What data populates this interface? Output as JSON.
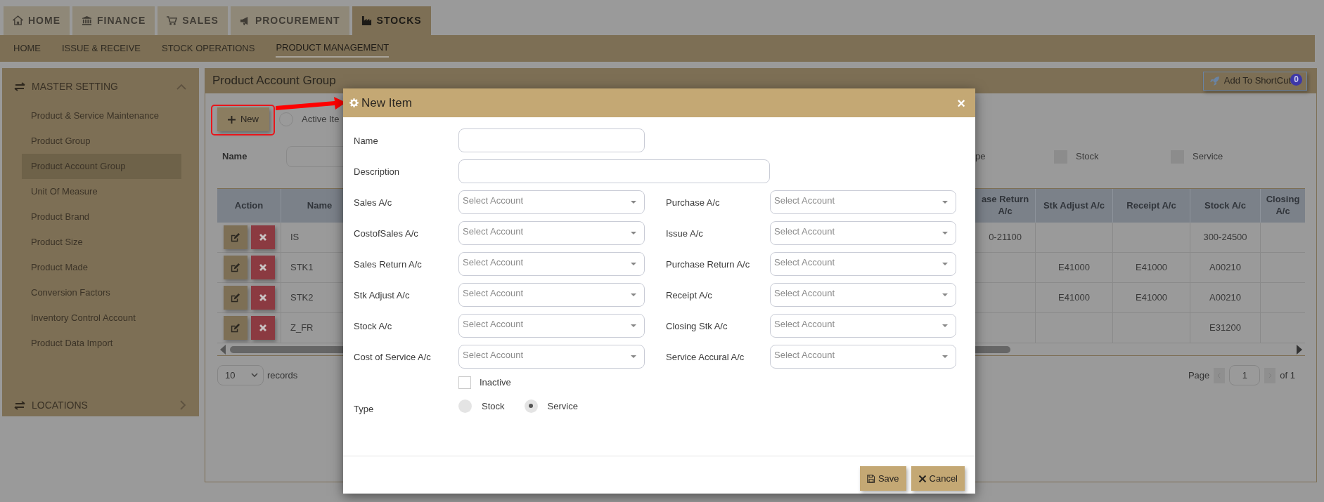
{
  "top_tabs": [
    {
      "label": "HOME",
      "selected": false
    },
    {
      "label": "FINANCE",
      "selected": false
    },
    {
      "label": "SALES",
      "selected": false
    },
    {
      "label": "PROCUREMENT",
      "selected": false
    },
    {
      "label": "STOCKS",
      "selected": true
    }
  ],
  "sub_nav": [
    {
      "label": "HOME",
      "selected": false
    },
    {
      "label": "ISSUE & RECEIVE",
      "selected": false
    },
    {
      "label": "STOCK OPERATIONS",
      "selected": false
    },
    {
      "label": "PRODUCT MANAGEMENT",
      "selected": true
    }
  ],
  "sidebar": {
    "sections": [
      {
        "title": "MASTER SETTING",
        "expanded": true,
        "items": [
          {
            "label": "Product & Service Maintenance",
            "selected": false
          },
          {
            "label": "Product Group",
            "selected": false
          },
          {
            "label": "Product Account Group",
            "selected": true
          },
          {
            "label": "Unit Of Measure",
            "selected": false
          },
          {
            "label": "Product Brand",
            "selected": false
          },
          {
            "label": "Product Size",
            "selected": false
          },
          {
            "label": "Product Made",
            "selected": false
          },
          {
            "label": "Conversion Factors",
            "selected": false
          },
          {
            "label": "Inventory Control Account",
            "selected": false
          },
          {
            "label": "Product Data Import",
            "selected": false
          }
        ]
      },
      {
        "title": "LOCATIONS",
        "expanded": false
      }
    ]
  },
  "panel": {
    "title": "Product Account Group",
    "shortcut_button": {
      "label": "Add To ShortCut",
      "badge": "0"
    },
    "new_button": "New",
    "active_filter": {
      "label": "Active Ite",
      "checked": false
    },
    "filters": {
      "name_label": "Name",
      "type_label": "pe",
      "type_options": [
        {
          "label": "Stock",
          "checked": false
        },
        {
          "label": "Service",
          "checked": false
        }
      ]
    },
    "table": {
      "left_columns": [
        "Action",
        "Name"
      ],
      "right_columns": [
        "ase Return A/c",
        "Stk Adjust A/c",
        "Receipt A/c",
        "Stock A/c",
        "Closing A/c"
      ],
      "rows": [
        {
          "name": "IS",
          "cells": [
            "0-21100",
            null,
            null,
            "300-24500",
            null
          ]
        },
        {
          "name": "STK1",
          "cells": [
            null,
            "E41000",
            "E41000",
            "A00210",
            null
          ]
        },
        {
          "name": "STK2",
          "cells": [
            null,
            "E41000",
            "E41000",
            "A00210",
            null
          ]
        },
        {
          "name": "Z_FR",
          "cells": [
            null,
            null,
            null,
            "E31200",
            null
          ]
        }
      ]
    },
    "page_size": "10",
    "records_label": "records",
    "pagination": {
      "page_label": "Page",
      "page": "1",
      "of_label": "of 1"
    }
  },
  "modal": {
    "title": "New Item",
    "close": "×",
    "fields": [
      {
        "kind": "text",
        "label": "Name",
        "wide": false
      },
      {
        "kind": "text",
        "label": "Description",
        "wide": true
      },
      {
        "kind": "select_pair",
        "items": [
          {
            "label": "Sales A/c",
            "placeholder": "Select Account"
          },
          {
            "label": "Purchase A/c",
            "placeholder": "Select Account"
          }
        ]
      },
      {
        "kind": "select_pair",
        "items": [
          {
            "label": "CostofSales A/c",
            "placeholder": "Select Account"
          },
          {
            "label": "Issue A/c",
            "placeholder": "Select Account"
          }
        ]
      },
      {
        "kind": "select_pair",
        "items": [
          {
            "label": "Sales Return A/c",
            "placeholder": "Select Account"
          },
          {
            "label": "Purchase Return A/c",
            "placeholder": "Select Account"
          }
        ]
      },
      {
        "kind": "select_pair",
        "items": [
          {
            "label": "Stk Adjust A/c",
            "placeholder": "Select Account"
          },
          {
            "label": "Receipt A/c",
            "placeholder": "Select Account"
          }
        ]
      },
      {
        "kind": "select_pair",
        "items": [
          {
            "label": "Stock A/c",
            "placeholder": "Select Account"
          },
          {
            "label": "Closing Stk A/c",
            "placeholder": "Select Account"
          }
        ]
      },
      {
        "kind": "select_pair",
        "items": [
          {
            "label": "Cost of Service A/c",
            "placeholder": "Select Account"
          },
          {
            "label": "Service Accural A/c",
            "placeholder": "Select Account"
          }
        ]
      },
      {
        "kind": "checkbox",
        "label": "Inactive",
        "checked": false
      },
      {
        "kind": "radio",
        "label": "Type",
        "options": [
          {
            "label": "Stock",
            "selected": false
          },
          {
            "label": "Service",
            "selected": true
          }
        ]
      }
    ],
    "buttons": [
      {
        "kind": "save",
        "label": "Save"
      },
      {
        "kind": "cancel",
        "label": "Cancel"
      }
    ]
  }
}
